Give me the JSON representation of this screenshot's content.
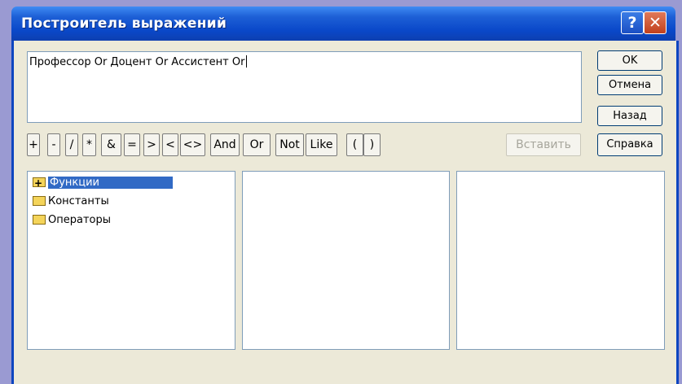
{
  "window": {
    "title": "Построитель выражений",
    "help": "?",
    "close": "✕"
  },
  "expression": {
    "value": "Профессор Or Доцент Or Ассистент Or"
  },
  "buttons": {
    "ok": "OK",
    "cancel": "Отмена",
    "back": "Назад",
    "insert": "Вставить",
    "help": "Справка"
  },
  "operators": [
    "+",
    "-",
    "/",
    "*",
    "&",
    "=",
    ">",
    "<",
    "<>",
    "And",
    "Or",
    "Not",
    "Like",
    "(",
    ")"
  ],
  "tree": [
    {
      "label": "Функции",
      "selected": true,
      "expandable": true
    },
    {
      "label": "Константы",
      "selected": false,
      "expandable": false
    },
    {
      "label": "Операторы",
      "selected": false,
      "expandable": false
    }
  ],
  "colors": {
    "titlebar": "#0a48c9",
    "selection": "#316ac5",
    "dialog_bg": "#ece9d8"
  }
}
